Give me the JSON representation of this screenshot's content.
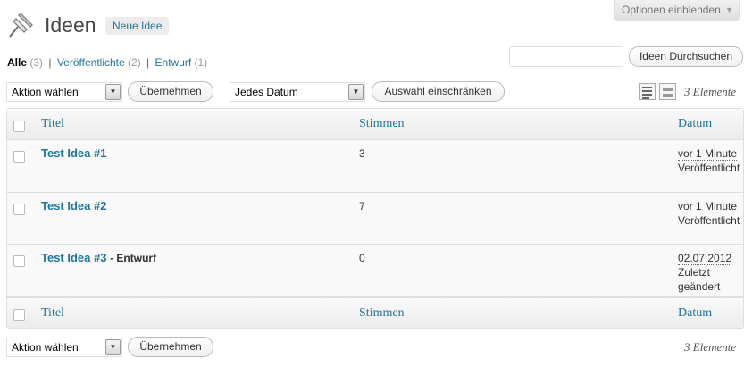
{
  "screen_options": {
    "label": "Optionen einblenden",
    "arrow": "▼"
  },
  "header": {
    "title": "Ideen",
    "add_new": "Neue Idee"
  },
  "views": [
    {
      "label": "Alle",
      "count": "(3)"
    },
    {
      "label": "Veröffentlichte",
      "count": "(2)"
    },
    {
      "label": "Entwurf",
      "count": "(1)"
    }
  ],
  "views_separator": "|",
  "search": {
    "value": "",
    "button": "Ideen Durchsuchen"
  },
  "tablenav_top": {
    "bulk_action": "Aktion wählen",
    "apply": "Übernehmen",
    "date_filter": "Jedes Datum",
    "filter_button": "Auswahl einschränken",
    "items": "3 Elemente"
  },
  "tablenav_bottom": {
    "bulk_action": "Aktion wählen",
    "apply": "Übernehmen",
    "items": "3 Elemente"
  },
  "columns": {
    "title": "Titel",
    "votes": "Stimmen",
    "date": "Datum"
  },
  "rows": [
    {
      "title": "Test Idea #1",
      "state": "",
      "votes": "3",
      "date": "vor 1 Minute",
      "status": "Veröffentlicht"
    },
    {
      "title": "Test Idea #2",
      "state": "",
      "votes": "7",
      "date": "vor 1 Minute",
      "status": "Veröffentlicht"
    },
    {
      "title": "Test Idea #3",
      "state": "- Entwurf",
      "votes": "0",
      "date": "02.07.2012",
      "status": "Zuletzt geändert"
    }
  ],
  "colors": {
    "link": "#21759b",
    "border": "#dfdfdf",
    "row_bg": "#f9f9f9"
  }
}
